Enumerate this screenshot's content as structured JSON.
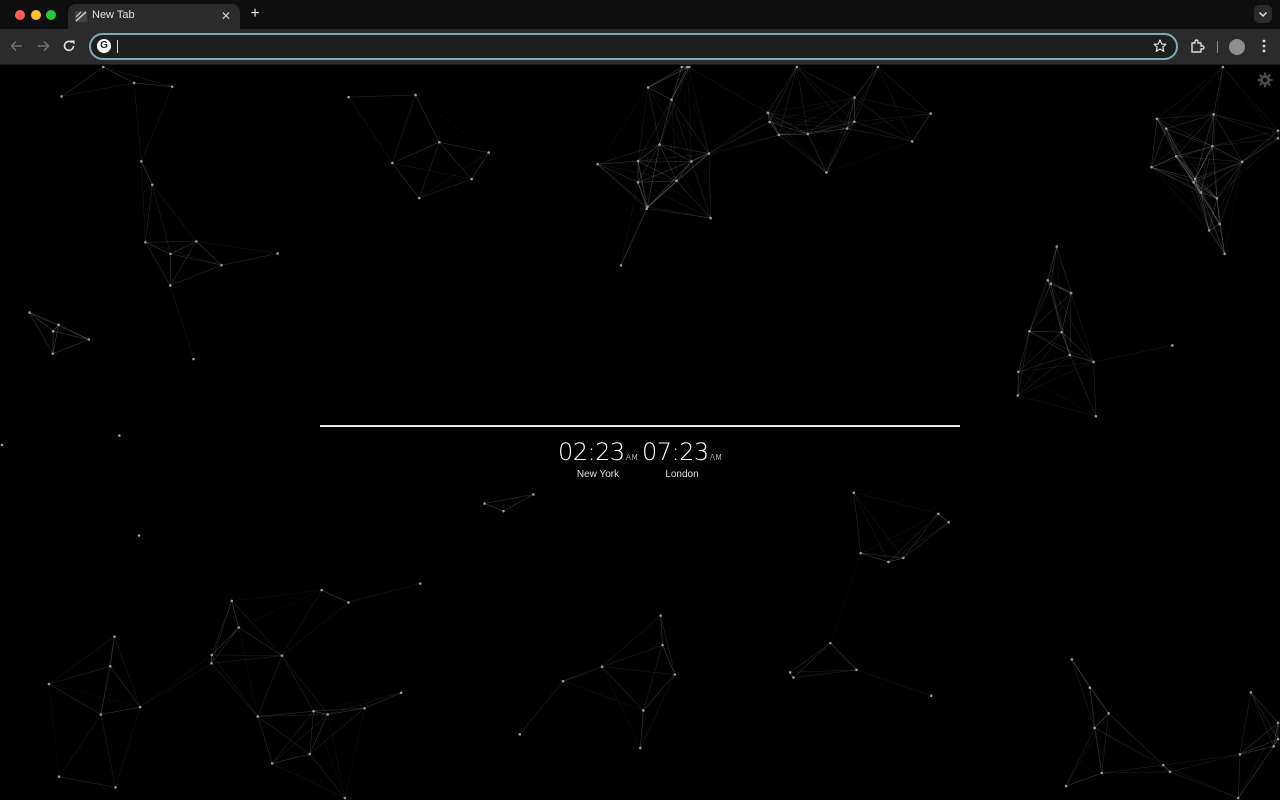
{
  "browser": {
    "tab": {
      "title": "New Tab",
      "close_glyph": "✕"
    },
    "new_tab_glyph": "+",
    "toolbar": {
      "back_icon": "arrow-left-icon",
      "forward_icon": "arrow-right-icon",
      "reload_icon": "reload-icon",
      "omnibox": {
        "value": "",
        "placeholder": "",
        "search_engine_glyph": "G"
      },
      "bookmark_icon": "star-icon",
      "extensions_icon": "puzzle-icon",
      "profile_icon": "avatar",
      "menu_icon": "kebab-menu-icon"
    },
    "accent_colors": {
      "omnibox_border": "#7cacb8",
      "background": "#000000"
    }
  },
  "page": {
    "settings_icon": "gear-icon",
    "clocks": [
      {
        "time": "02:23",
        "ampm": "AM",
        "city": "New York"
      },
      {
        "time": "07:23",
        "ampm": "AM",
        "city": "London"
      }
    ]
  }
}
